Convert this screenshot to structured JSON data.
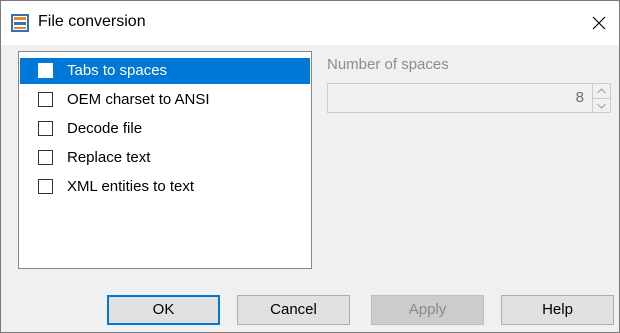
{
  "window": {
    "title": "File conversion",
    "app_icon": "file-conversion-app-icon",
    "close_icon": "close-icon"
  },
  "options_list": {
    "items": [
      {
        "label": "Tabs to spaces",
        "checked": false,
        "selected": true
      },
      {
        "label": "OEM charset to ANSI",
        "checked": false,
        "selected": false
      },
      {
        "label": "Decode file",
        "checked": false,
        "selected": false
      },
      {
        "label": "Replace text",
        "checked": false,
        "selected": false
      },
      {
        "label": "XML entities to text",
        "checked": false,
        "selected": false
      }
    ]
  },
  "spaces": {
    "label": "Number of spaces",
    "value": "8",
    "enabled": false
  },
  "buttons": {
    "ok": "OK",
    "cancel": "Cancel",
    "apply": "Apply",
    "help": "Help"
  },
  "colors": {
    "selection": "#0078d7",
    "dialog_bg": "#f0f0f0",
    "disabled_text": "#8c8c8c"
  }
}
